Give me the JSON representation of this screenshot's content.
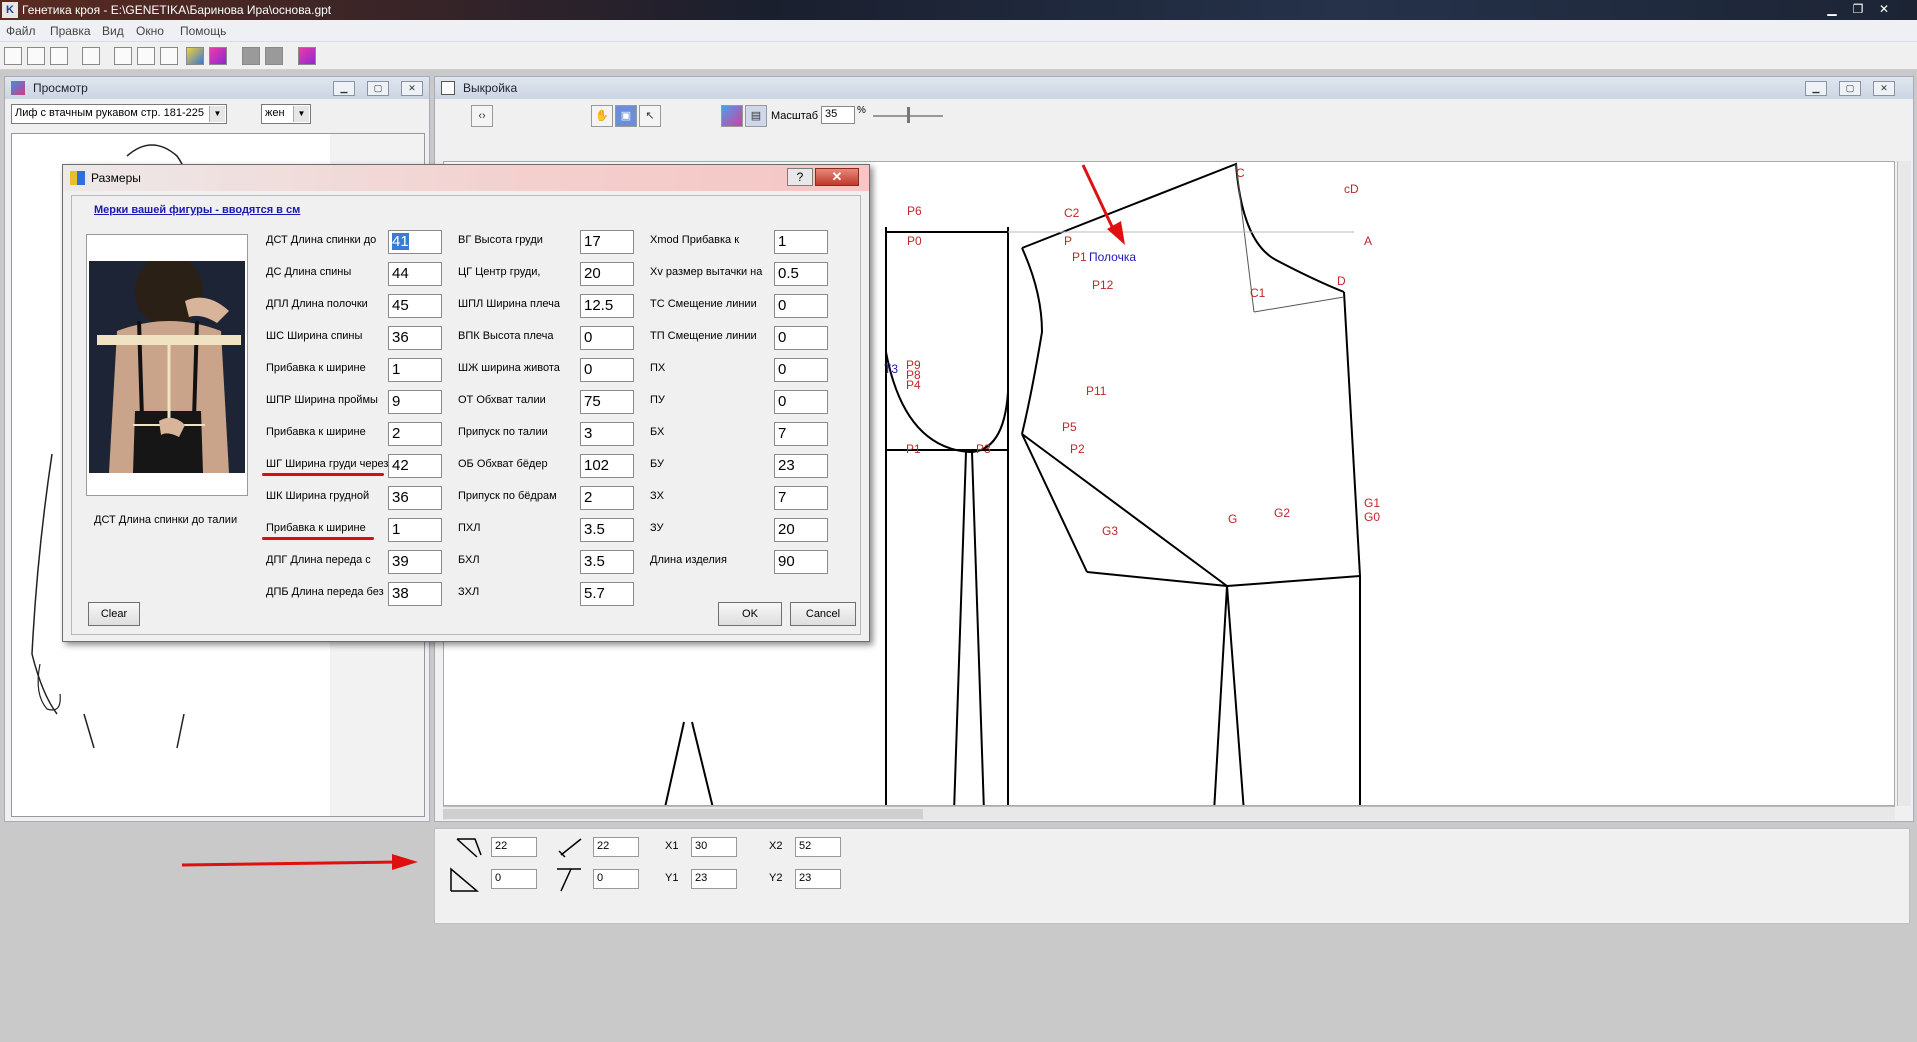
{
  "window": {
    "title": "Генетика кроя - E:\\GENETIKA\\Баринова Ира\\основа.gpt",
    "app_icon": "K"
  },
  "menu": {
    "file": "Файл",
    "edit": "Правка",
    "view": "Вид",
    "window": "Окно",
    "help": "Помощь"
  },
  "preview": {
    "title": "Просмотр",
    "model_select": "Лиф с втачным рукавом стр. 181-225",
    "gender_select": "жен"
  },
  "pattern": {
    "title": "Выкройка",
    "scale_label": "Масштаб",
    "scale_value": "35",
    "scale_unit": "%",
    "points": {
      "p6": "P6",
      "c2": "C2",
      "c": "C",
      "cd": "cD",
      "p0": "P0",
      "p": "P",
      "p1": "P1",
      "polochka": "Полочка",
      "a": "A",
      "c1": "C1",
      "d": "D",
      "p12": "P12",
      "p11": "P11",
      "p5": "P5",
      "p4": "P4",
      "p8": "P8",
      "p9": "P9",
      "t3": "T3",
      "p1b": "P1",
      "p3": "P3",
      "p2": "P2",
      "g": "G",
      "g2": "G2",
      "g1": "G1",
      "g0": "G0",
      "g3": "G3"
    }
  },
  "coords": {
    "field1": "22",
    "field2": "22",
    "field3": "0",
    "field4": "0",
    "x1_label": "X1",
    "x1": "30",
    "x2_label": "X2",
    "x2": "52",
    "y1_label": "Y1",
    "y1": "23",
    "y2_label": "Y2",
    "y2": "23"
  },
  "dialog": {
    "title": "Размеры",
    "help": "?",
    "close": "✕",
    "header": "Мерки вашей фигуры - вводятся в см",
    "photo_caption": "ДСТ Длина спинки до талии",
    "clear": "Clear",
    "ok": "OK",
    "cancel": "Cancel",
    "col1": [
      {
        "label": "ДСТ Длина спинки до",
        "value": "41"
      },
      {
        "label": "ДС Длина спины",
        "value": "44"
      },
      {
        "label": "ДПЛ Длина полочки",
        "value": "45"
      },
      {
        "label": "ШС Ширина спины",
        "value": "36"
      },
      {
        "label": "Прибавка к ширине",
        "value": "1"
      },
      {
        "label": "ШПР Ширина проймы",
        "value": "9"
      },
      {
        "label": "Прибавка к ширине",
        "value": "2"
      },
      {
        "label": "ШГ Ширина груди через",
        "value": "42"
      },
      {
        "label": "ШК Ширина грудной",
        "value": "36"
      },
      {
        "label": "Прибавка к ширине",
        "value": "1"
      },
      {
        "label": "ДПГ Длина переда с",
        "value": "39"
      },
      {
        "label": "ДПБ Длина переда без",
        "value": "38"
      }
    ],
    "col2": [
      {
        "label": "ВГ Высота груди",
        "value": "17"
      },
      {
        "label": "ЦГ Центр груди,",
        "value": "20"
      },
      {
        "label": "ШПЛ Ширина плеча",
        "value": "12.5"
      },
      {
        "label": "ВПК Высота плеча",
        "value": "0"
      },
      {
        "label": "ШЖ ширина живота",
        "value": "0"
      },
      {
        "label": "ОТ Обхват талии",
        "value": "75"
      },
      {
        "label": "Припуск по талии",
        "value": "3"
      },
      {
        "label": "ОБ Обхват бёдер",
        "value": "102"
      },
      {
        "label": "Припуск по бёдрам",
        "value": "2"
      },
      {
        "label": "ПХЛ",
        "value": "3.5"
      },
      {
        "label": "БХЛ",
        "value": "3.5"
      },
      {
        "label": "ЗХЛ",
        "value": "5.7"
      }
    ],
    "col3": [
      {
        "label": "Xmod Прибавка к",
        "value": "1"
      },
      {
        "label": "Xv размер вытачки на",
        "value": "0.5"
      },
      {
        "label": "ТС Смещение линии",
        "value": "0"
      },
      {
        "label": "ТП Смещение линии",
        "value": "0"
      },
      {
        "label": "ПХ",
        "value": "0"
      },
      {
        "label": "ПУ",
        "value": "0"
      },
      {
        "label": "БХ",
        "value": "7"
      },
      {
        "label": "БУ",
        "value": "23"
      },
      {
        "label": "ЗХ",
        "value": "7"
      },
      {
        "label": "ЗУ",
        "value": "20"
      },
      {
        "label": "Длина изделия",
        "value": "90"
      }
    ]
  }
}
